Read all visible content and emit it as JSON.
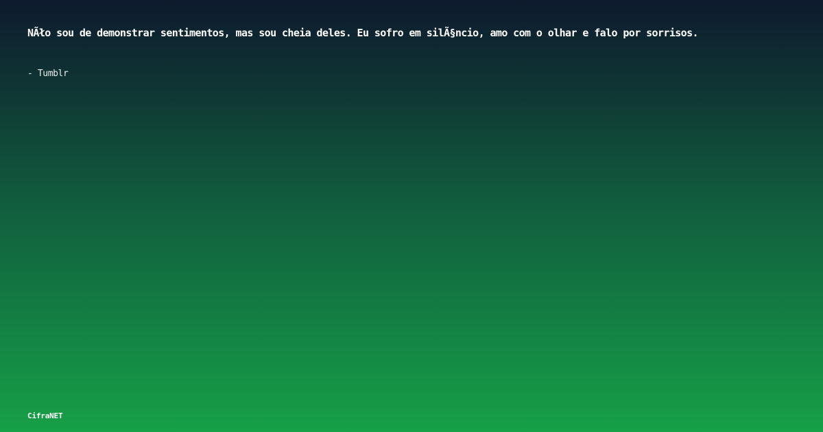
{
  "quote": {
    "text": "NÃło sou de demonstrar sentimentos, mas sou cheia deles. Eu sofro em silÃ§ncio, amo com o olhar e falo por sorrisos.",
    "author": "- Tumblr"
  },
  "brand": {
    "name": "CifraNET"
  },
  "colors": {
    "gradient_top": "#0e1a2e",
    "gradient_bottom": "#16a047",
    "text": "#ffffff"
  }
}
